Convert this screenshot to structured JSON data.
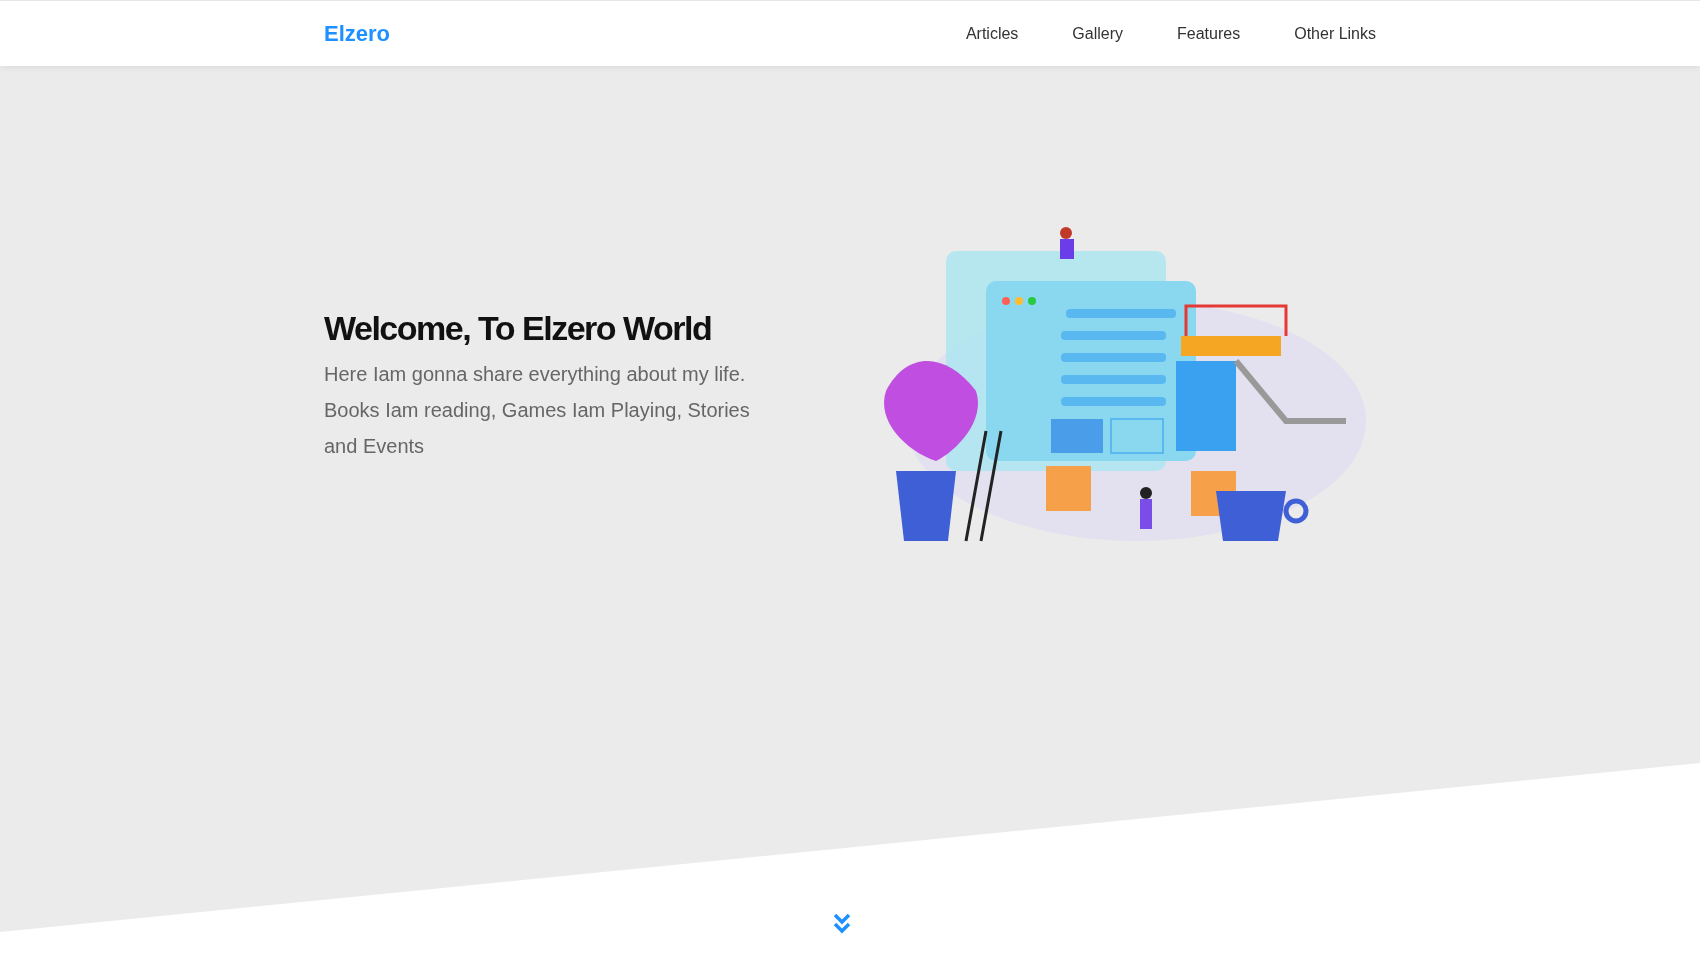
{
  "navbar": {
    "logo": "Elzero",
    "links": [
      {
        "label": "Articles"
      },
      {
        "label": "Gallery"
      },
      {
        "label": "Features"
      },
      {
        "label": "Other Links"
      }
    ]
  },
  "hero": {
    "title": "Welcome, To Elzero World",
    "text": "Here Iam gonna share everything about my life. Books Iam reading, Games Iam Playing, Stories and Events"
  }
}
